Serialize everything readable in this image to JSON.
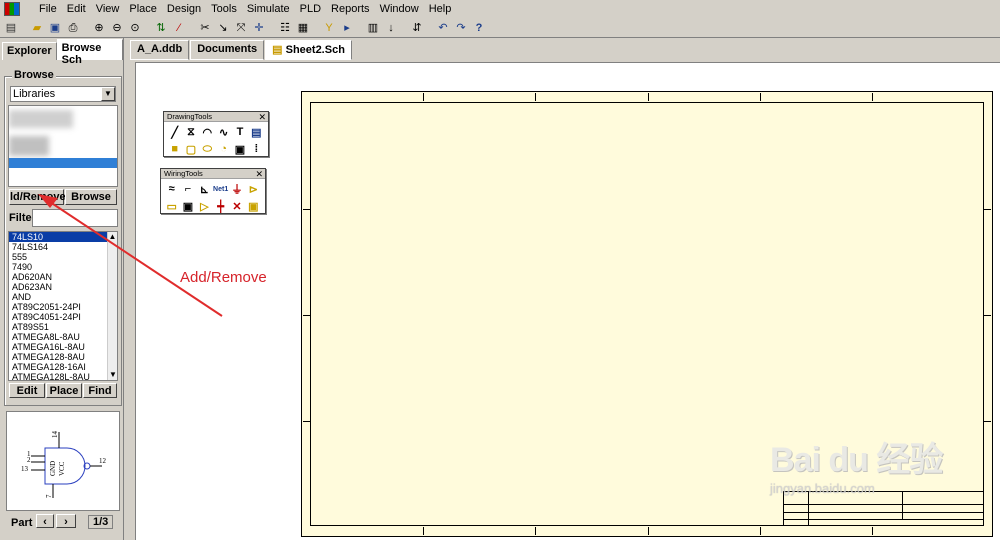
{
  "menu": [
    "File",
    "Edit",
    "View",
    "Place",
    "Design",
    "Tools",
    "Simulate",
    "PLD",
    "Reports",
    "Window",
    "Help"
  ],
  "left_panel": {
    "tabs": [
      "Explorer",
      "Browse Sch"
    ],
    "browse_title": "Browse",
    "browse_combo": "Libraries",
    "add_remove_button": "ld/Remove",
    "browse_button": "Browse",
    "filter_label": "Filte",
    "components": [
      "74LS10",
      "74LS164",
      "555",
      "7490",
      "AD620AN",
      "AD623AN",
      "AND",
      "AT89C2051-24PI",
      "AT89C4051-24PI",
      "AT89S51",
      "ATMEGA8L-8AU",
      "ATMEGA16L-8AU",
      "ATMEGA128-8AU",
      "ATMEGA128-16AI",
      "ATMEGA128L-8AU"
    ],
    "edit_button": "Edit",
    "place_button": "Place",
    "find_button": "Find",
    "part_label": "Part",
    "part_page": "1/3"
  },
  "preview_pins": {
    "p14": "14",
    "p1": "1",
    "p2": "2",
    "p13": "13",
    "p12": "12",
    "p7": "7",
    "gnd": "GND",
    "vcc": "VCC"
  },
  "doc_tabs": [
    "A_A.ddb",
    "Documents",
    "Sheet2.Sch"
  ],
  "palettes": {
    "drawing": "DrawingTools",
    "wiring": "WiringTools",
    "wiring_net": "Net1"
  },
  "annotation": {
    "label": "Add/Remove",
    "color": "#d6232a"
  },
  "watermark": {
    "line1": "Bai du 经验",
    "line2": "jingyan.baidu.com"
  }
}
